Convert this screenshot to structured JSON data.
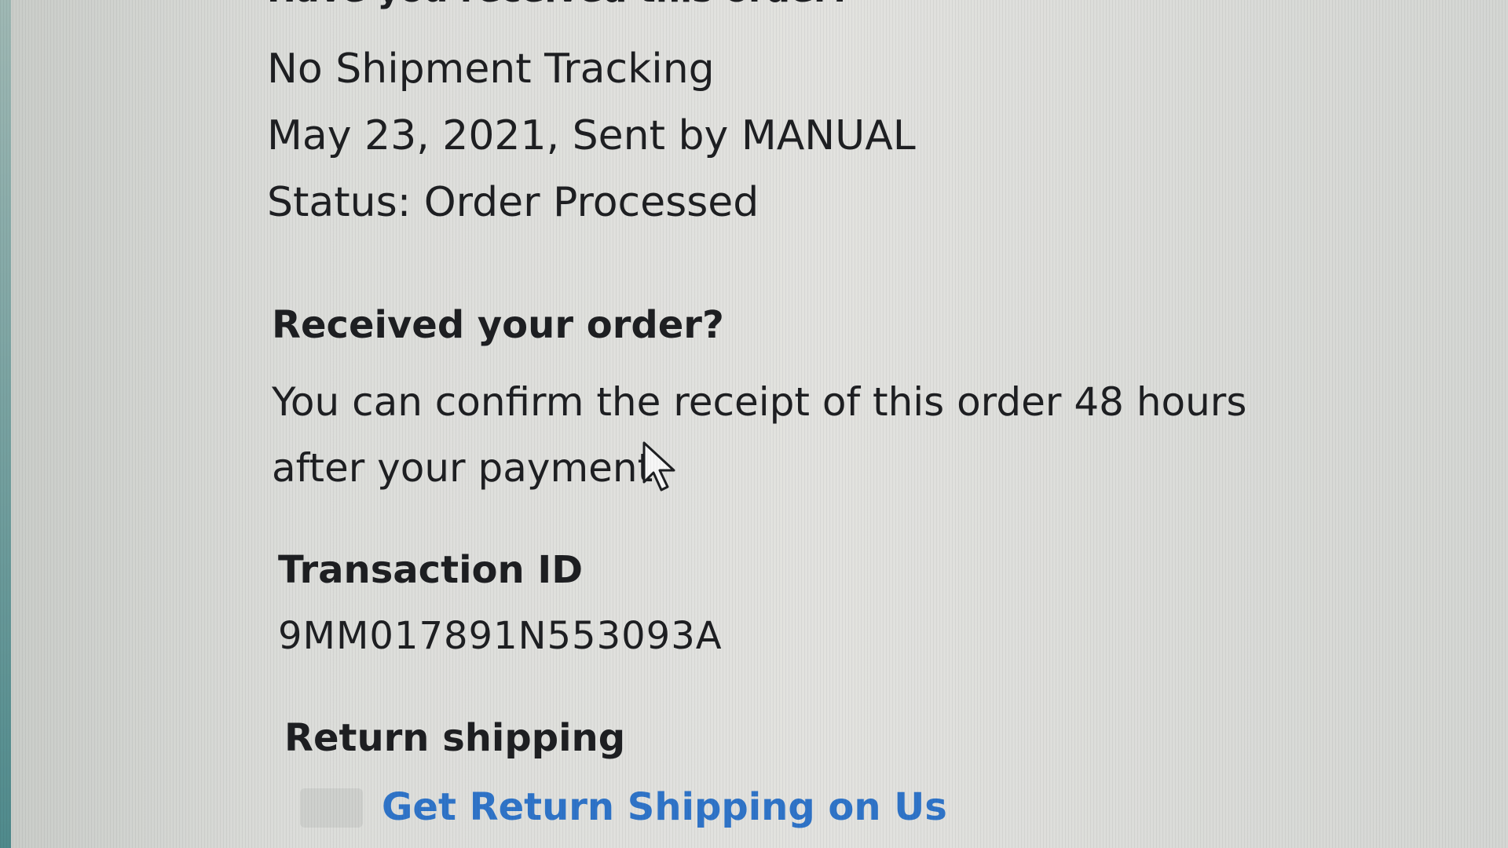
{
  "order": {
    "received_question_cut": "Have you received this order?",
    "tracking_title": "No Shipment Tracking",
    "tracking_date": "May 23, 2021, Sent by MANUAL",
    "status": "Status: Order Processed"
  },
  "received": {
    "heading": "Received your order?",
    "text": "You can confirm the receipt of this order 48 hours after your payment."
  },
  "transaction": {
    "label": "Transaction ID",
    "id": "9MM017891N553093A"
  },
  "return_shipping": {
    "label": "Return shipping",
    "link": "Get Return Shipping on Us"
  },
  "colors": {
    "link": "#2f74c8",
    "text": "#1e1f22"
  },
  "icons": {
    "cursor": "mouse-pointer-icon"
  }
}
